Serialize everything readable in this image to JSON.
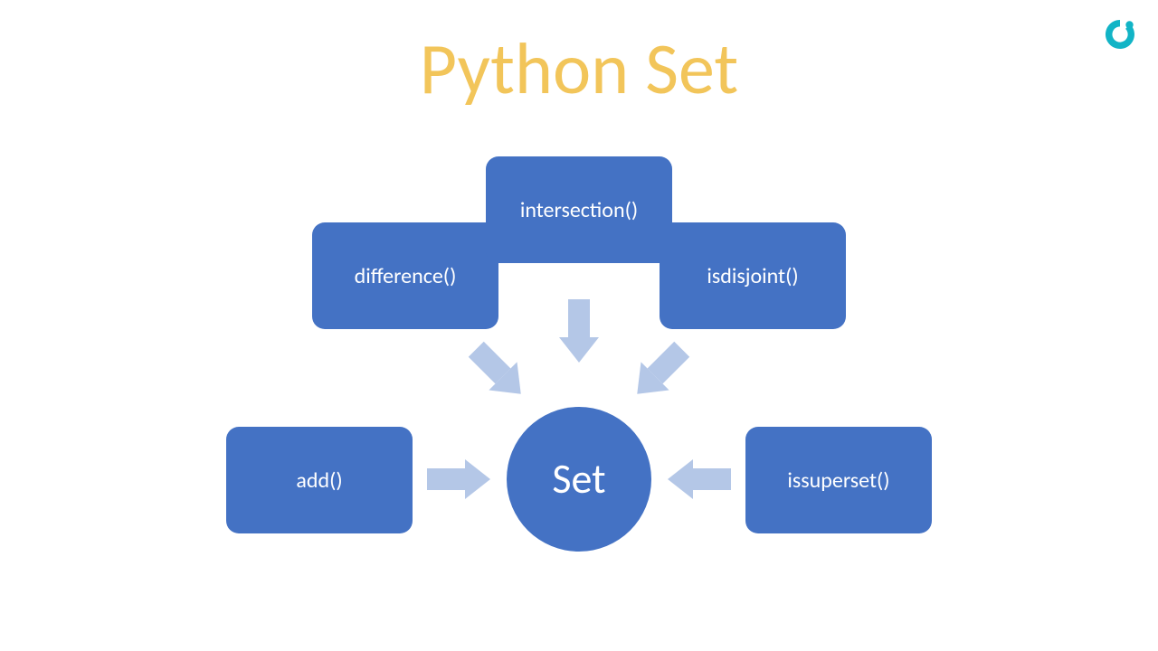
{
  "title": "Python Set",
  "center": {
    "label": "Set"
  },
  "nodes": {
    "n1": {
      "label": "add()"
    },
    "n2": {
      "label": "difference()"
    },
    "n3": {
      "label": "intersection()"
    },
    "n4": {
      "label": "isdisjoint()"
    },
    "n5": {
      "label": "issuperset()"
    }
  },
  "colors": {
    "box_fill": "#4472c4",
    "arrow_fill": "#b4c7e7",
    "title": "#f2c55a",
    "logo": "#12b4c6"
  }
}
